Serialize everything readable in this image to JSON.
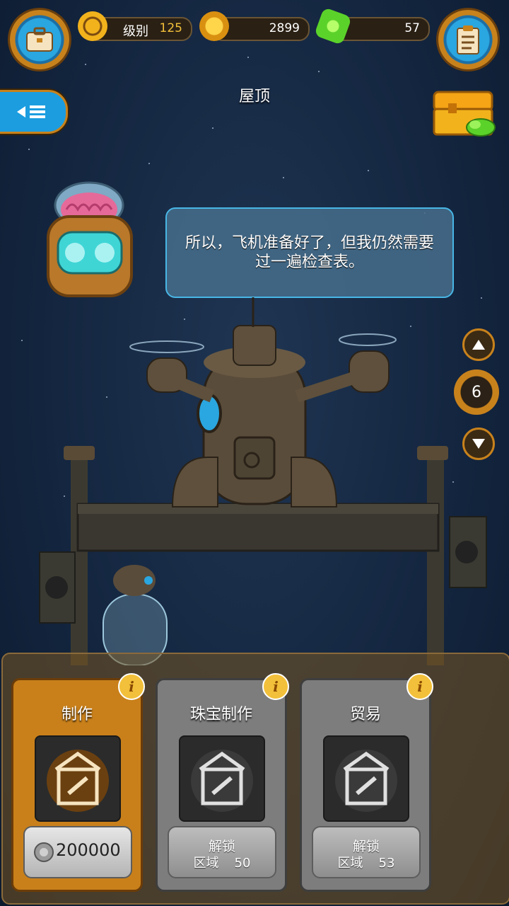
{
  "header": {
    "level_label": "级别",
    "level_value": "125",
    "coins": "2899",
    "gems": "57"
  },
  "title": "屋顶",
  "dialog": {
    "text": "所以，飞机准备好了，但我仍然需要过一遍检查表。"
  },
  "level_switcher": {
    "current": "6"
  },
  "cards": [
    {
      "title": "制作",
      "price": "200000",
      "state": "active"
    },
    {
      "title": "珠宝制作",
      "unlock_label": "解锁",
      "area_label": "区域",
      "area_number": "50",
      "state": "locked"
    },
    {
      "title": "贸易",
      "unlock_label": "解锁",
      "area_label": "区域",
      "area_number": "53",
      "state": "locked"
    }
  ],
  "colors": {
    "accent_orange": "#c9801a",
    "accent_blue": "#1b9de0",
    "gem_green": "#5bd22a",
    "coin_gold": "#f2b21c"
  }
}
